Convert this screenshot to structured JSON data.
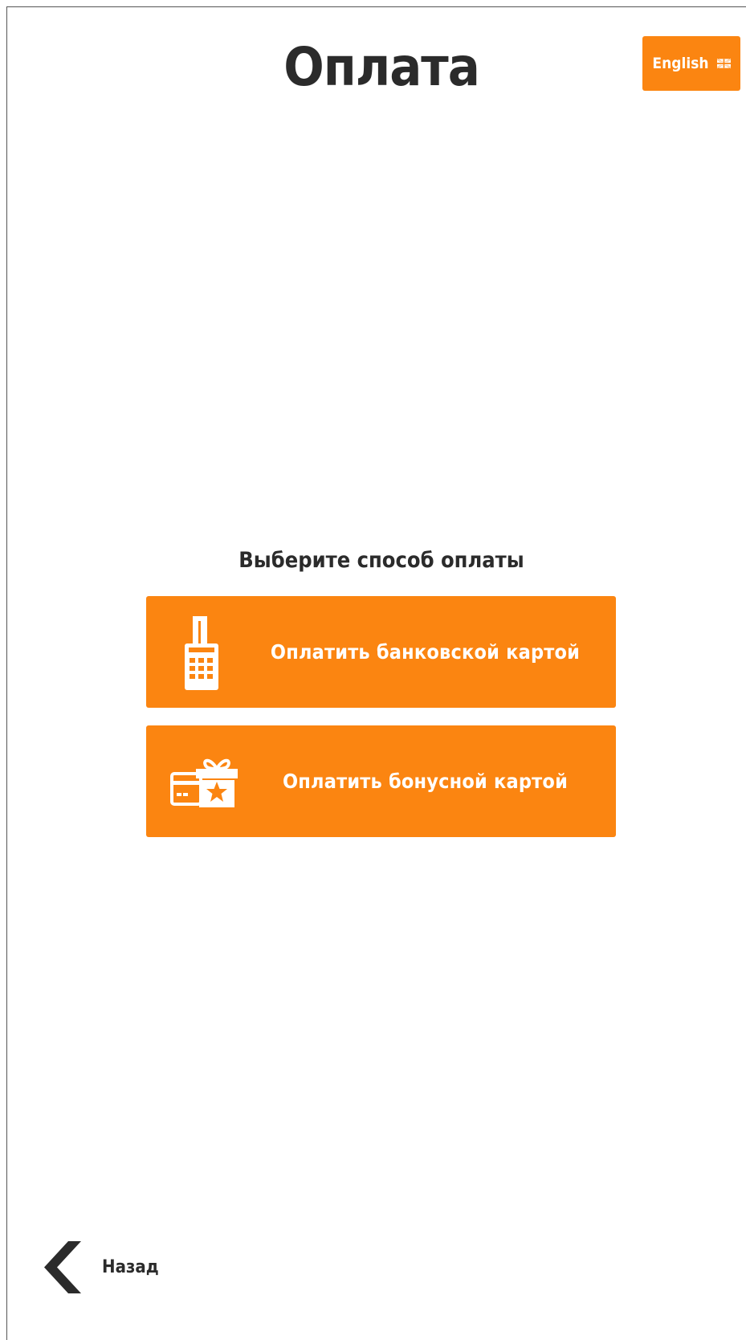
{
  "header": {
    "title": "Оплата",
    "language_button_label": "English",
    "language_flag_icon": "uk-flag-icon"
  },
  "main": {
    "prompt": "Выберите способ оплаты",
    "options": [
      {
        "label": "Оплатить банковской картой",
        "icon": "card-terminal-icon"
      },
      {
        "label": "Оплатить бонусной картой",
        "icon": "gift-card-icon"
      }
    ]
  },
  "footer": {
    "back_label": "Назад",
    "back_icon": "chevron-left-icon"
  },
  "colors": {
    "accent": "#fb8511",
    "text": "#2b2b2b",
    "button_text": "#ffffff",
    "background": "#ffffff"
  }
}
